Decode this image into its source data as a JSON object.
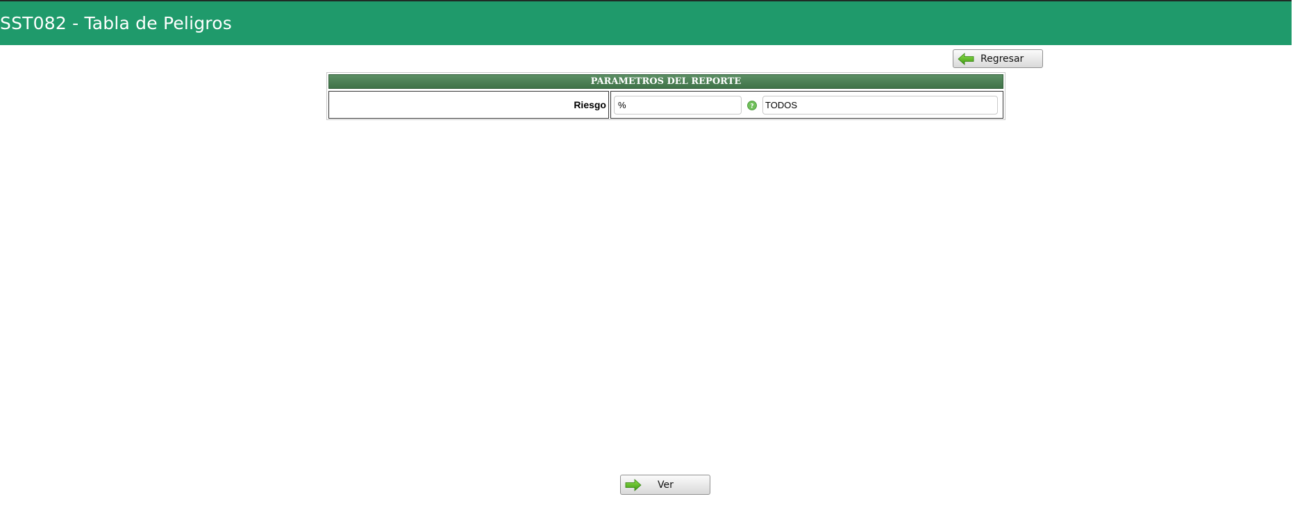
{
  "header": {
    "title": "SST082 - Tabla de Peligros"
  },
  "toolbar": {
    "back_label": "Regresar",
    "back_icon": "arrow-left-icon"
  },
  "params": {
    "title": "PARAMETROS DEL REPORTE",
    "fields": [
      {
        "label": "Riesgo",
        "code_value": "%",
        "help_icon": "help-icon",
        "description_value": "TODOS"
      }
    ]
  },
  "footer": {
    "view_label": "Ver",
    "view_icon": "arrow-right-icon"
  },
  "colors": {
    "header_bg": "#1f9a6b",
    "section_header_bg": "#4a7f53",
    "arrow_green": "#5cbf2a"
  }
}
